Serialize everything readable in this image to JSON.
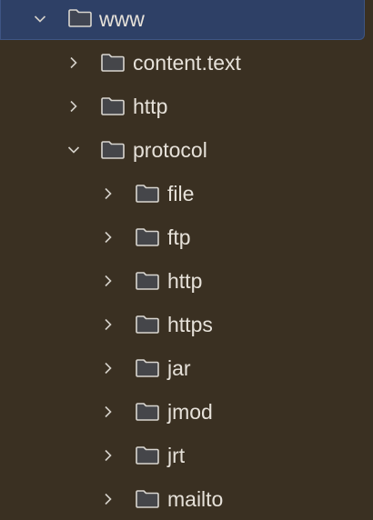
{
  "tree": {
    "nodes": [
      {
        "label": "www",
        "expanded": true,
        "selected": true,
        "icon": "folder-icon"
      },
      {
        "label": "content.text",
        "expanded": false,
        "icon": "folder-icon"
      },
      {
        "label": "http",
        "expanded": false,
        "icon": "folder-icon"
      },
      {
        "label": "protocol",
        "expanded": true,
        "icon": "folder-icon"
      },
      {
        "label": "file",
        "expanded": false,
        "icon": "folder-icon"
      },
      {
        "label": "ftp",
        "expanded": false,
        "icon": "folder-icon"
      },
      {
        "label": "http",
        "expanded": false,
        "icon": "folder-icon"
      },
      {
        "label": "https",
        "expanded": false,
        "icon": "folder-icon"
      },
      {
        "label": "jar",
        "expanded": false,
        "icon": "folder-icon"
      },
      {
        "label": "jmod",
        "expanded": false,
        "icon": "folder-icon"
      },
      {
        "label": "jrt",
        "expanded": false,
        "icon": "folder-icon"
      },
      {
        "label": "mailto",
        "expanded": false,
        "icon": "folder-icon"
      }
    ]
  },
  "colors": {
    "background": "#3a3022",
    "selection": "#2e4066",
    "folder_fill": "#45464a",
    "folder_stroke": "#d9d6d0"
  }
}
